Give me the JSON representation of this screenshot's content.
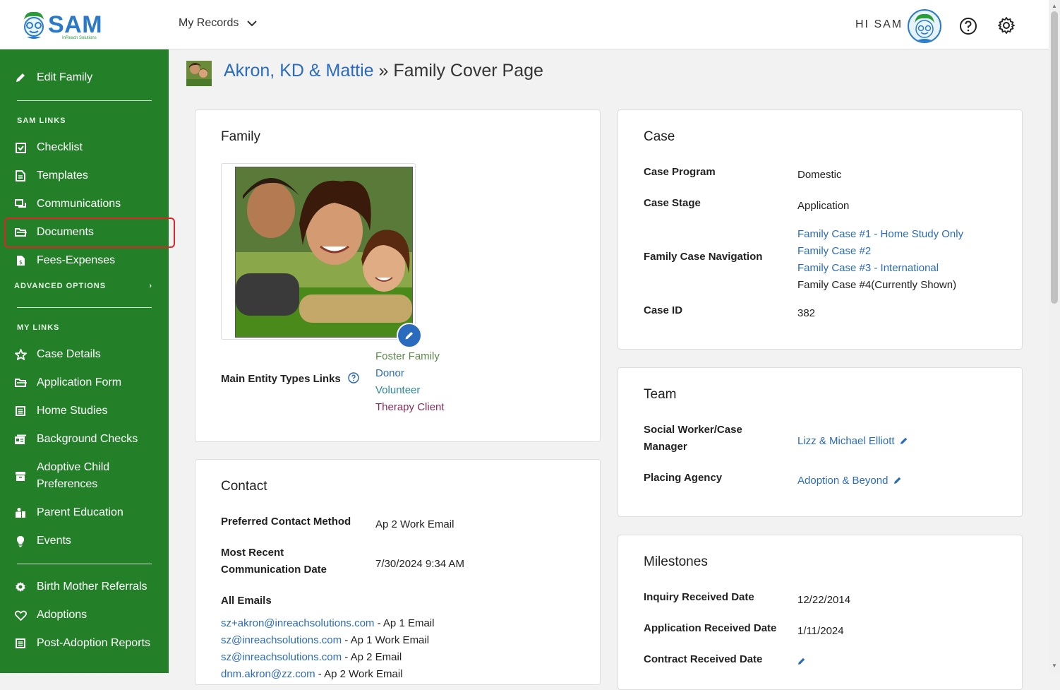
{
  "app": {
    "logo_text": "SAM",
    "logo_subtext": "InReach Solutions",
    "my_records_label": "My Records",
    "greeting": "HI SAM"
  },
  "sidebar": {
    "edit_family": "Edit Family",
    "sam_links_title": "SAM LINKS",
    "sam_links": [
      {
        "label": "Checklist",
        "icon": "checklist-icon"
      },
      {
        "label": "Templates",
        "icon": "templates-icon"
      },
      {
        "label": "Communications",
        "icon": "communications-icon"
      },
      {
        "label": "Documents",
        "icon": "folder-icon"
      },
      {
        "label": "Fees-Expenses",
        "icon": "fees-icon"
      }
    ],
    "advanced_options": "ADVANCED OPTIONS",
    "my_links_title": "MY LINKS",
    "my_links": [
      {
        "label": "Case Details",
        "icon": "star-icon"
      },
      {
        "label": "Application Form",
        "icon": "folder-open-icon"
      },
      {
        "label": "Home Studies",
        "icon": "list-icon"
      },
      {
        "label": "Background Checks",
        "icon": "background-check-icon"
      },
      {
        "label": "Adoptive Child",
        "label2": "Preferences",
        "icon": "box-icon"
      },
      {
        "label": "Parent Education",
        "icon": "education-icon"
      },
      {
        "label": "Events",
        "icon": "lightbulb-icon"
      }
    ],
    "other_links": [
      {
        "label": "Birth Mother Referrals",
        "icon": "gear-badge-icon"
      },
      {
        "label": "Adoptions",
        "icon": "heart-icon"
      },
      {
        "label": "Post-Adoption Reports",
        "icon": "report-icon"
      }
    ]
  },
  "header": {
    "family_name": "Akron, KD & Mattie",
    "separator": " » ",
    "page_name": "Family Cover Page"
  },
  "family_card": {
    "title": "Family",
    "entity_types_label": "Main Entity Types Links",
    "entity_types": [
      {
        "label": "Foster Family",
        "color": "#5a8a4a"
      },
      {
        "label": "Donor",
        "color": "#2a6bbf"
      },
      {
        "label": "Volunteer",
        "color": "#2a8a9a"
      },
      {
        "label": "Therapy Client",
        "color": "#8a2a5a"
      }
    ]
  },
  "contact_card": {
    "title": "Contact",
    "preferred_label": "Preferred Contact Method",
    "preferred_value": "Ap 2 Work Email",
    "recent_label_1": "Most Recent",
    "recent_label_2": "Communication Date",
    "recent_value": "7/30/2024 9:34 AM",
    "all_emails_label": "All Emails",
    "emails": [
      {
        "address": "sz+akron@inreachsolutions.com",
        "type": " - Ap 1 Email"
      },
      {
        "address": "sz@inreachsolutions.com",
        "type": " - Ap 1 Work Email"
      },
      {
        "address": "sz@inreachsolutions.com",
        "type": " - Ap 2 Email"
      },
      {
        "address": "dnm.akron@zz.com",
        "type": " - Ap 2 Work Email"
      }
    ]
  },
  "case_card": {
    "title": "Case",
    "program_label": "Case Program",
    "program_value": "Domestic",
    "stage_label": "Case Stage",
    "stage_value": "Application",
    "nav_label": "Family Case Navigation",
    "nav_links": [
      "Family Case #1 - Home Study Only",
      "Family Case #2",
      "Family Case #3 - International"
    ],
    "nav_current": "Family Case #4(Currently Shown)",
    "id_label": "Case ID",
    "id_value": "382"
  },
  "team_card": {
    "title": "Team",
    "sw_label_1": "Social Worker/Case",
    "sw_label_2": "Manager",
    "sw_value": "Lizz & Michael Elliott",
    "agency_label": "Placing Agency",
    "agency_value": "Adoption & Beyond"
  },
  "milestones_card": {
    "title": "Milestones",
    "inquiry_label": "Inquiry Received Date",
    "inquiry_value": "12/22/2014",
    "application_label": "Application Received Date",
    "application_value": "1/11/2024",
    "contract_label": "Contract Received Date"
  },
  "colors": {
    "sidebar_bg": "#238029",
    "link": "#2a6bbf",
    "highlight_border": "#e0242a"
  }
}
